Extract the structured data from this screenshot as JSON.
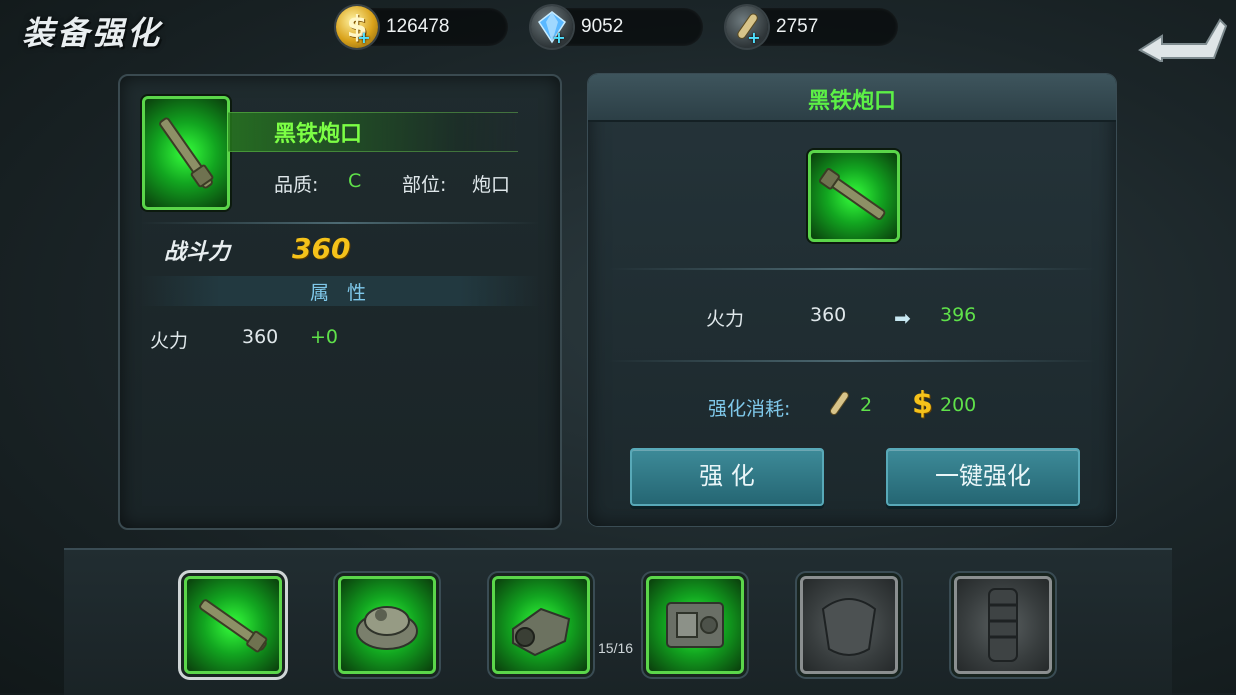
{
  "header": {
    "title": "装备强化",
    "resources": [
      {
        "name": "gold",
        "icon": "dollar-coin-icon",
        "value": "126478"
      },
      {
        "name": "diamond",
        "icon": "diamond-icon",
        "value": "9052"
      },
      {
        "name": "material",
        "icon": "shell-icon",
        "value": "2757"
      }
    ]
  },
  "left_panel": {
    "item_name": "黑铁炮口",
    "quality_label": "品质:",
    "quality_value": "C",
    "slot_label": "部位:",
    "slot_value": "炮口",
    "combat_label": "战斗力",
    "combat_value": "360",
    "attr_title": "属 性",
    "attr_name": "火力",
    "attr_value": "360",
    "attr_bonus": "+0"
  },
  "right_panel": {
    "title": "黑铁炮口",
    "stat_name": "火力",
    "stat_current": "360",
    "stat_next": "396",
    "cost_label": "强化消耗:",
    "cost_material": "2",
    "cost_gold": "200",
    "btn_upgrade": "强 化",
    "btn_auto_upgrade": "一键强化"
  },
  "bottom": {
    "page": "15/16"
  },
  "colors": {
    "accent_green": "#5fe14a",
    "gold_text": "#f5c21a",
    "button_teal": "#2f7a88"
  }
}
